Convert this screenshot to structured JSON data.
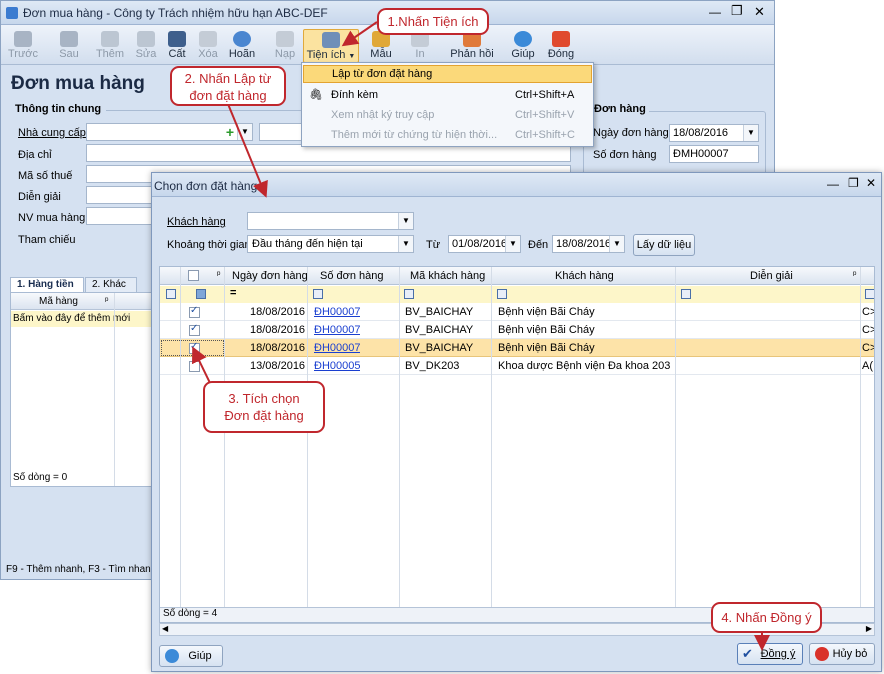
{
  "main_window": {
    "title": "Đơn mua hàng - Công ty Trách nhiệm hữu hạn ABC-DEF",
    "heading": "Đơn mua hàng",
    "toolbar": [
      "Trước",
      "Sau",
      "Thêm",
      "Sửa",
      "Cất",
      "Xóa",
      "Hoãn",
      "Nạp",
      "Tiện ích",
      "Mẫu",
      "In",
      "Phản hồi",
      "Giúp",
      "Đóng"
    ]
  },
  "general": {
    "section": "Thông tin chung",
    "labels": [
      "Nhà cung cấp",
      "Địa chỉ",
      "Mã số thuế",
      "Diễn giải",
      "NV mua hàng",
      "Tham chiếu"
    ]
  },
  "order": {
    "section": "Đơn hàng",
    "date_label": "Ngày đơn hàng",
    "date_value": "18/08/2016",
    "number_label": "Số đơn hàng",
    "number_value": "ĐMH00007"
  },
  "tabs": [
    "1. Hàng tiền",
    "2. Khác"
  ],
  "detail": {
    "col": "Mã hàng",
    "add_row": "Bấm vào đây để thêm mới",
    "count": "Số dòng = 0"
  },
  "status_bar": "F9 - Thêm nhanh, F3 - Tìm nhanh",
  "menu": {
    "items": [
      {
        "label": "Lập từ đơn đặt hàng",
        "shortcut": ""
      },
      {
        "label": "Đính kèm",
        "shortcut": "Ctrl+Shift+A"
      },
      {
        "label": "Xem nhật ký truy cập",
        "shortcut": "Ctrl+Shift+V"
      },
      {
        "label": "Thêm mới từ chứng từ hiện thời...",
        "shortcut": "Ctrl+Shift+C"
      }
    ]
  },
  "dialog": {
    "title": "Chọn đơn đặt hàng",
    "customer_label": "Khách hàng",
    "period_label": "Khoảng thời gian",
    "period_value": "Đầu tháng đến hiện tại",
    "from_label": "Từ",
    "from_value": "01/08/2016",
    "to_label": "Đến",
    "to_value": "18/08/2016",
    "fetch_button": "Lấy dữ liệu",
    "columns": [
      "Ngày đơn hàng",
      "Số đơn hàng",
      "Mã khách hàng",
      "Khách hàng",
      "Diễn giải"
    ],
    "filter_eq": "=",
    "rows": [
      {
        "checked": true,
        "date": "18/08/2016",
        "number": "ĐH00007",
        "code": "BV_BAICHAY",
        "customer": "Bệnh viện Bãi Cháy",
        "desc": "C>"
      },
      {
        "checked": true,
        "date": "18/08/2016",
        "number": "ĐH00007",
        "code": "BV_BAICHAY",
        "customer": "Bệnh viện Bãi Cháy",
        "desc": "C>"
      },
      {
        "checked": true,
        "date": "18/08/2016",
        "number": "ĐH00007",
        "code": "BV_BAICHAY",
        "customer": "Bệnh viện Bãi Cháy",
        "desc": "C>"
      },
      {
        "checked": false,
        "date": "13/08/2016",
        "number": "ĐH00005",
        "code": "BV_DK203",
        "customer": "Khoa dược Bệnh viện Đa khoa 203",
        "desc": "A("
      }
    ],
    "count": "Số dòng = 4",
    "help_button": "Giúp",
    "ok_button": "Đồng ý",
    "cancel_button": "Hủy bỏ"
  },
  "callouts": [
    "1.Nhấn Tiện ích",
    "2. Nhấn Lập từ\nđơn đặt hàng",
    "3. Tích chọn\nĐơn đặt hàng",
    "4. Nhấn Đồng ý"
  ],
  "colors": {
    "accent": "#c0272d",
    "selection": "#fde3a8",
    "window_bg": "#d5e1f1"
  }
}
